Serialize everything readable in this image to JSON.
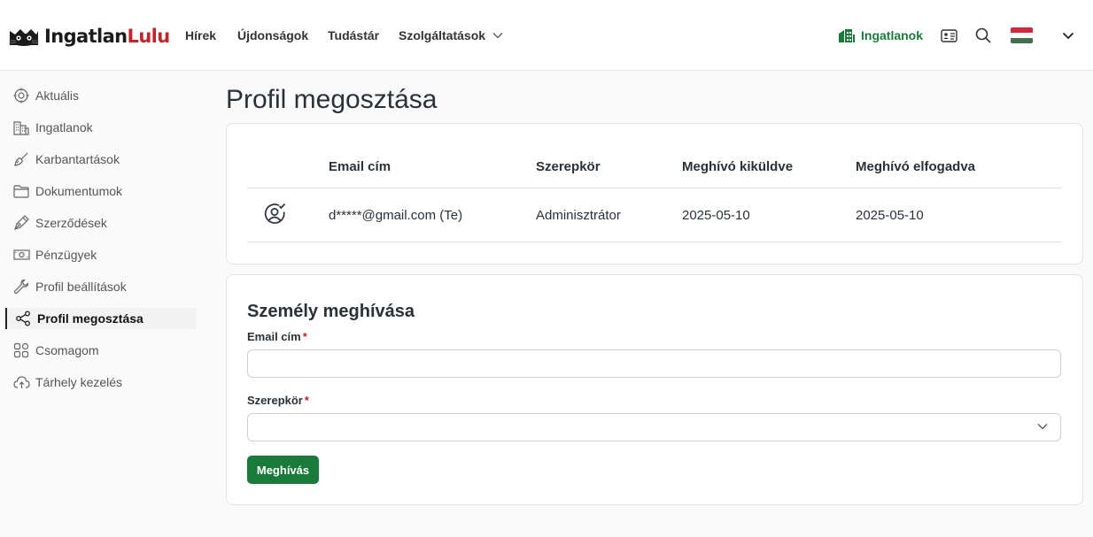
{
  "header": {
    "logo_a": "Ingatlan",
    "logo_b": "Lulu",
    "nav": [
      {
        "label": "Hírek"
      },
      {
        "label": "Újdonságok"
      },
      {
        "label": "Tudástár"
      },
      {
        "label": "Szolgáltatások"
      }
    ],
    "ingatlanok_label": "Ingatlanok",
    "icons": {
      "properties": "building-icon",
      "id_card": "id-card-icon",
      "search": "search-icon",
      "language": "hungarian-flag-icon",
      "menu": "chevron-down-icon"
    },
    "flag_colors": [
      "#cd2a3e",
      "#ffffff",
      "#436f4d"
    ]
  },
  "sidebar": {
    "items": [
      {
        "label": "Aktuális",
        "icon": "target-icon"
      },
      {
        "label": "Ingatlanok",
        "icon": "buildings-icon"
      },
      {
        "label": "Karbantartások",
        "icon": "brush-icon"
      },
      {
        "label": "Dokumentumok",
        "icon": "folder-icon"
      },
      {
        "label": "Szerződések",
        "icon": "pen-icon"
      },
      {
        "label": "Pénzügyek",
        "icon": "cash-icon"
      },
      {
        "label": "Profil beállítások",
        "icon": "wrench-icon"
      },
      {
        "label": "Profil megosztása",
        "icon": "share-icon",
        "active": true
      },
      {
        "label": "Csomagom",
        "icon": "grid-icon"
      },
      {
        "label": "Tárhely kezelés",
        "icon": "cloud-upload-icon"
      }
    ]
  },
  "main": {
    "title": "Profil megosztása",
    "table": {
      "headers": [
        "Email cím",
        "Szerepkör",
        "Meghívó kiküldve",
        "Meghívó elfogadva"
      ],
      "rows": [
        {
          "icon": "user-check-icon",
          "email": "d*****@gmail.com (Te)",
          "role": "Adminisztrátor",
          "sent": "2025-05-10",
          "accepted": "2025-05-10"
        }
      ]
    },
    "invite": {
      "title": "Személy meghívása",
      "email_label": "Email cím",
      "email_value": "",
      "role_label": "Szerepkör",
      "role_value": "",
      "required_mark": "*",
      "button_label": "Meghívás"
    }
  },
  "colors": {
    "accent_green": "#1a7a3c",
    "logo_red": "#c0272d"
  }
}
